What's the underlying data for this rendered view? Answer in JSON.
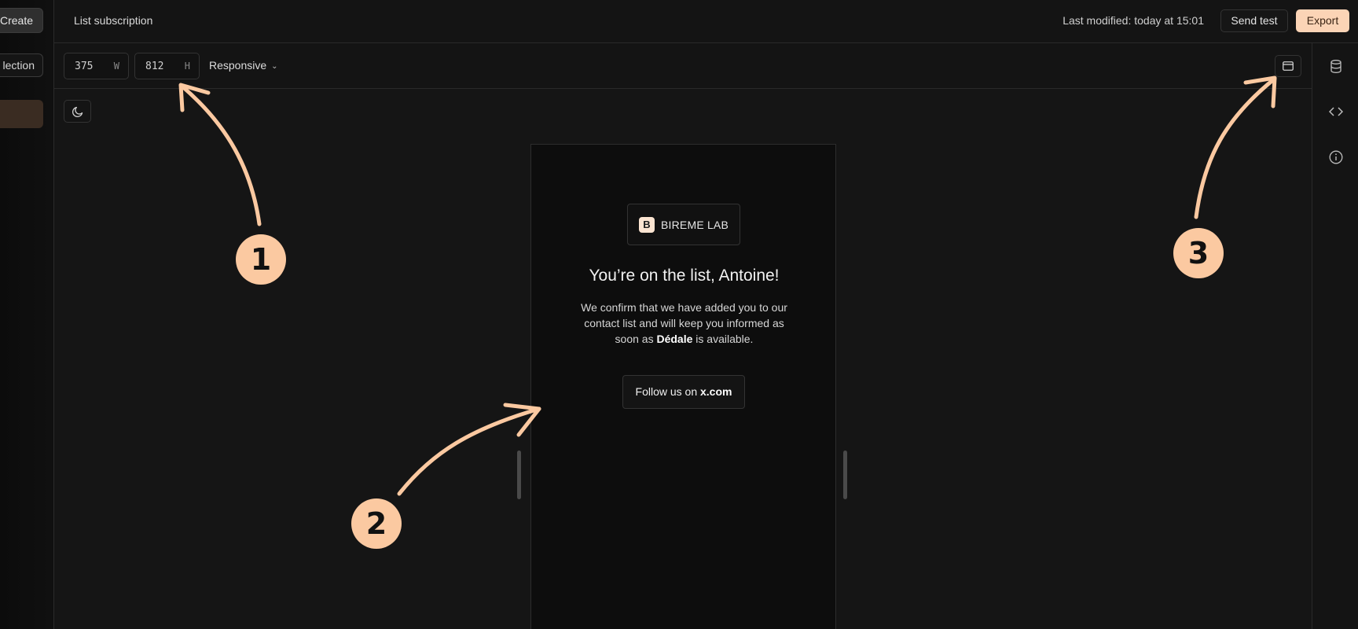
{
  "left_sidebar": {
    "create_label": "Create",
    "selection_label": "lection"
  },
  "topbar": {
    "title": "List subscription",
    "last_modified": "Last modified: today at 15:01",
    "send_test_label": "Send test",
    "export_label": "Export"
  },
  "toolbar": {
    "width_value": "375",
    "width_unit": "W",
    "height_value": "812",
    "height_unit": "H",
    "mode_label": "Responsive"
  },
  "email": {
    "brand_initial": "B",
    "brand_name": "BIREME LAB",
    "title": "You’re on the list, Antoine!",
    "body_before": "We confirm that we have added you to our contact list and will keep you informed as soon as ",
    "body_product": "Dédale",
    "body_after": " is available.",
    "button_prefix": "Follow us on ",
    "button_site": "x.com"
  },
  "annotations": {
    "badge_1": "1",
    "badge_2": "2",
    "badge_3": "3",
    "color": "#fbc9a1"
  },
  "icons": {
    "toolbar_right": "layout-panel-icon",
    "theme": "moon-icon",
    "rail": [
      "database-icon",
      "code-icon",
      "info-icon"
    ]
  },
  "colors": {
    "accent": "#fbd4b6",
    "background": "#141414"
  }
}
